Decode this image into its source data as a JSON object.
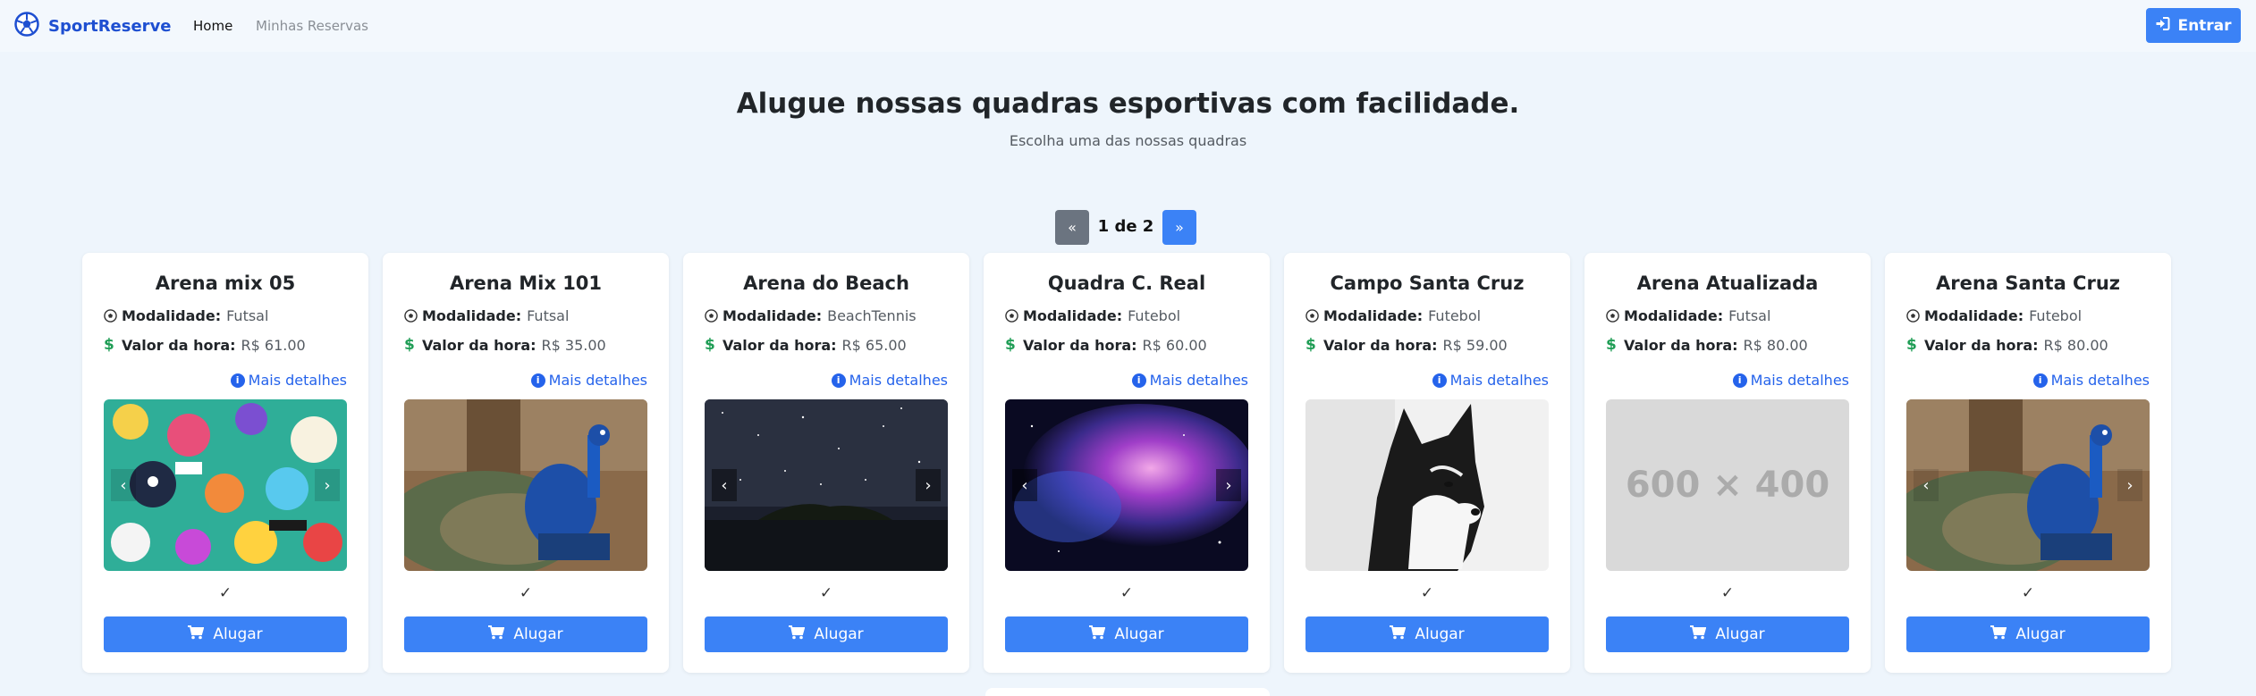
{
  "navbar": {
    "brand": "SportReserve",
    "links": [
      {
        "label": "Home"
      },
      {
        "label": "Minhas Reservas"
      }
    ],
    "login_label": "Entrar"
  },
  "hero": {
    "title": "Alugue nossas quadras esportivas com facilidade.",
    "subtitle": "Escolha uma das nossas quadras"
  },
  "pagination": {
    "prev": "«",
    "label": "1 de 2",
    "next": "»"
  },
  "card_labels": {
    "modalidade": "Modalidade:",
    "valor": "Valor da hora:",
    "details": "Mais detalhes",
    "check": "✓",
    "rent": "Alugar"
  },
  "courts": [
    {
      "name": "Arena mix 05",
      "modality": "Futsal",
      "price": "R$ 61.00",
      "image": "graffiti-stickers"
    },
    {
      "name": "Arena Mix 101",
      "modality": "Futsal",
      "price": "R$ 35.00",
      "image": "peacock"
    },
    {
      "name": "Arena do Beach",
      "modality": "BeachTennis",
      "price": "R$ 65.00",
      "image": "starry-night-island"
    },
    {
      "name": "Quadra C. Real",
      "modality": "Futebol",
      "price": "R$ 60.00",
      "image": "galaxy-nebula"
    },
    {
      "name": "Campo Santa Cruz",
      "modality": "Futebol",
      "price": "R$ 59.00",
      "image": "husky-dog"
    },
    {
      "name": "Arena Atualizada",
      "modality": "Futsal",
      "price": "R$ 80.00",
      "image": "placeholder",
      "placeholder_text": "600 × 400"
    },
    {
      "name": "Arena Santa Cruz",
      "modality": "Futebol",
      "price": "R$ 80.00",
      "image": "peacock"
    }
  ],
  "colors": {
    "primary": "#3b82f6",
    "brand": "#1e4fd1",
    "price_icon": "#1f9d55",
    "link": "#2563eb",
    "background": "#eef5fc"
  }
}
